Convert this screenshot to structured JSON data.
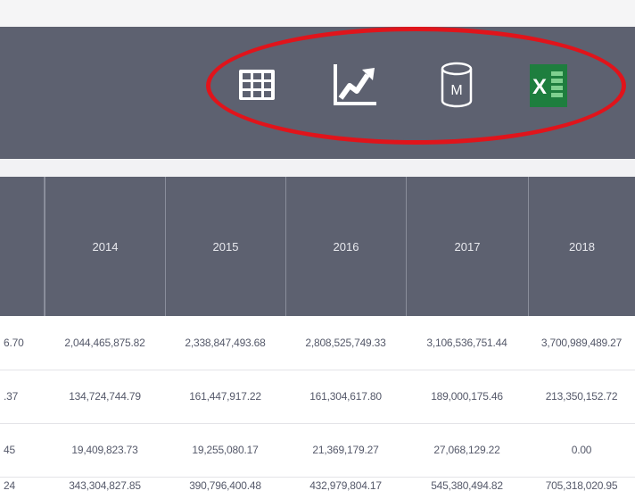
{
  "toolbar": {
    "icons": [
      {
        "name": "table-icon"
      },
      {
        "name": "line-chart-icon"
      },
      {
        "name": "database-icon",
        "glyph": "M"
      },
      {
        "name": "excel-icon",
        "glyph": "X"
      }
    ],
    "colors": {
      "bar": "#5d6170",
      "icon": "#ffffff",
      "excel_green": "#1e7e3e",
      "highlight": "#e0141b"
    }
  },
  "table": {
    "headers": [
      "",
      "2014",
      "2015",
      "2016",
      "2017",
      "2018"
    ],
    "rows": [
      [
        "6.70",
        "2,044,465,875.82",
        "2,338,847,493.68",
        "2,808,525,749.33",
        "3,106,536,751.44",
        "3,700,989,489.27"
      ],
      [
        ".37",
        "134,724,744.79",
        "161,447,917.22",
        "161,304,617.80",
        "189,000,175.46",
        "213,350,152.72"
      ],
      [
        "45",
        "19,409,823.73",
        "19,255,080.17",
        "21,369,179.27",
        "27,068,129.22",
        "0.00"
      ],
      [
        "24",
        "343,304,827.85",
        "390,796,400.48",
        "432,979,804.17",
        "545,380,494.82",
        "705,318,020.95"
      ]
    ]
  }
}
